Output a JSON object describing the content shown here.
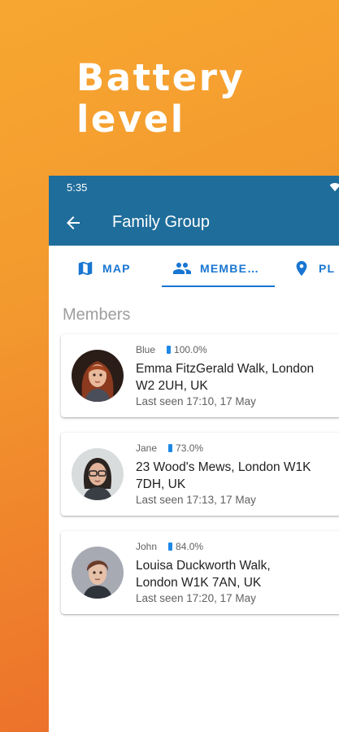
{
  "promo": {
    "line1": "Battery",
    "line2": "level"
  },
  "status_bar": {
    "time": "5:35"
  },
  "app_bar": {
    "title": "Family Group"
  },
  "tabs": [
    {
      "label": "MAP",
      "icon": "map-icon"
    },
    {
      "label": "MEMBE…",
      "icon": "group-icon",
      "selected": true
    },
    {
      "label": "PL",
      "icon": "place-icon"
    }
  ],
  "section": {
    "title": "Members"
  },
  "members": [
    {
      "name": "Blue",
      "battery": "100.0%",
      "address": "Emma FitzGerald Walk, London W2 2UH, UK",
      "last_seen": "Last seen 17:10, 17 May"
    },
    {
      "name": "Jane",
      "battery": "73.0%",
      "address": "23 Wood's Mews, London W1K 7DH, UK",
      "last_seen": "Last seen 17:13, 17 May"
    },
    {
      "name": "John",
      "battery": "84.0%",
      "address": "Louisa Duckworth Walk, London W1K 7AN, UK",
      "last_seen": "Last seen 17:20, 17 May"
    }
  ],
  "colors": {
    "primary": "#1f6d9b",
    "accent": "#1976d2",
    "battery": "#1e88e5"
  }
}
